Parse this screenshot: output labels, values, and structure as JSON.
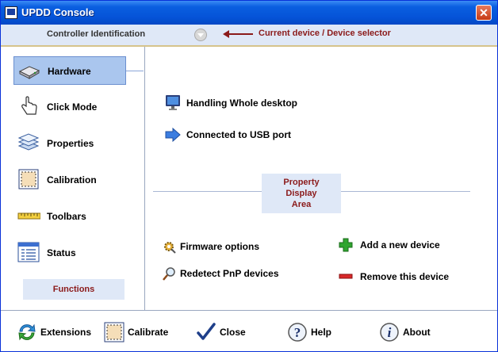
{
  "window": {
    "title": "UPDD Console",
    "close_glyph": "✕"
  },
  "controller_bar": {
    "label": "Controller Identification",
    "annotation": "Current device / Device selector"
  },
  "sidebar": {
    "items": [
      {
        "label": "Hardware",
        "icon": "hardware-icon",
        "selected": true
      },
      {
        "label": "Click Mode",
        "icon": "pointing-hand-icon"
      },
      {
        "label": "Properties",
        "icon": "properties-layers-icon"
      },
      {
        "label": "Calibration",
        "icon": "calibration-icon"
      },
      {
        "label": "Toolbars",
        "icon": "ruler-icon"
      },
      {
        "label": "Status",
        "icon": "status-list-icon"
      }
    ],
    "functions_label": "Functions"
  },
  "main": {
    "info": [
      {
        "label": "Handling Whole desktop",
        "icon": "monitor-icon"
      },
      {
        "label": "Connected to USB port",
        "icon": "arrow-right-icon"
      }
    ],
    "property_area": {
      "line1": "Property",
      "line2": "Display",
      "line3": "Area"
    },
    "functions": [
      {
        "label": "Firmware options",
        "icon": "gear-wrench-icon"
      },
      {
        "label": "Redetect PnP devices",
        "icon": "magnifier-icon"
      },
      {
        "label": "Add a new device",
        "icon": "plus-icon"
      },
      {
        "label": "Remove this device",
        "icon": "minus-icon"
      }
    ]
  },
  "bottom": {
    "buttons": [
      {
        "label": "Extensions",
        "icon": "refresh-arrows-icon"
      },
      {
        "label": "Calibrate",
        "icon": "calibrate-icon"
      },
      {
        "label": "Close",
        "icon": "checkmark-icon"
      },
      {
        "label": "Help",
        "icon": "help-icon"
      },
      {
        "label": "About",
        "icon": "info-icon"
      }
    ]
  },
  "colors": {
    "accent_red": "#8b1a1a",
    "panel_blue": "#dfe8f7",
    "selection": "#aac6ee",
    "title_blue": "#0553d8"
  }
}
